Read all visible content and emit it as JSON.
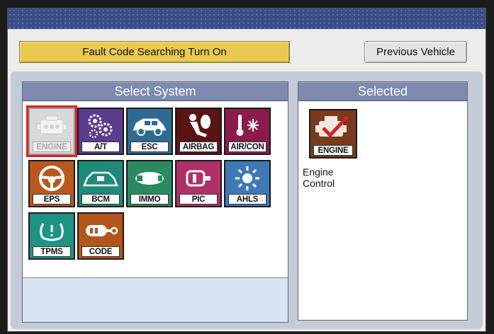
{
  "toolbar": {
    "fault_label": "Fault Code Searching Turn On",
    "previous_label": "Previous Vehicle"
  },
  "select_panel": {
    "title": "Select System",
    "systems": [
      {
        "label": "ENGINE",
        "icon": "engine-icon",
        "color": "#d8d8d8",
        "enabled": false,
        "highlighted": true
      },
      {
        "label": "A/T",
        "icon": "gears-icon",
        "color": "#5b3d8f",
        "enabled": true
      },
      {
        "label": "ESC",
        "icon": "car-icon",
        "color": "#2f6a94",
        "enabled": true
      },
      {
        "label": "AIRBAG",
        "icon": "airbag-icon",
        "color": "#5a1414",
        "enabled": true
      },
      {
        "label": "AIR/CON",
        "icon": "thermometer-snowflake-icon",
        "color": "#8a1c4c",
        "enabled": true
      },
      {
        "label": "EPS",
        "icon": "steering-wheel-icon",
        "color": "#b8581c",
        "enabled": true
      },
      {
        "label": "BCM",
        "icon": "car-body-icon",
        "color": "#1f8a7a",
        "enabled": true
      },
      {
        "label": "IMMO",
        "icon": "key-icon",
        "color": "#2c8a60",
        "enabled": true
      },
      {
        "label": "PIC",
        "icon": "smart-key-icon",
        "color": "#b0306a",
        "enabled": true
      },
      {
        "label": "AHLS",
        "icon": "headlamp-icon",
        "color": "#3d79b4",
        "enabled": true
      },
      {
        "label": "TPMS",
        "icon": "tire-pressure-icon",
        "color": "#1f9484",
        "enabled": true
      },
      {
        "label": "CODE",
        "icon": "code-key-icon",
        "color": "#b4561c",
        "enabled": true
      }
    ]
  },
  "selected_panel": {
    "title": "Selected",
    "system_label": "ENGINE",
    "system_name": "Engine Control",
    "icon": "engine-check-icon",
    "color": "#7a3a1c"
  }
}
